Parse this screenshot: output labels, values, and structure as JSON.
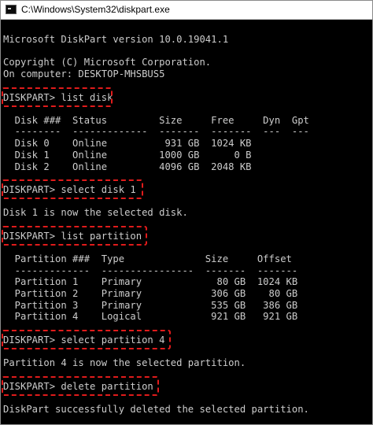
{
  "window": {
    "title": "C:\\Windows\\System32\\diskpart.exe"
  },
  "console": {
    "version_line": "Microsoft DiskPart version 10.0.19041.1",
    "copyright_line": "Copyright (C) Microsoft Corporation.",
    "computer_line": "On computer: DESKTOP-MHSBUS5",
    "cmd_list_disk": "DISKPART> list disk",
    "disk_header": "  Disk ###  Status         Size     Free     Dyn  Gpt",
    "disk_separator": "  --------  -------------  -------  -------  ---  ---",
    "disk_rows": [
      "  Disk 0    Online          931 GB  1024 KB",
      "  Disk 1    Online         1000 GB      0 B",
      "  Disk 2    Online         4096 GB  2048 KB"
    ],
    "cmd_select_disk": "DISKPART> select disk 1",
    "msg_disk_selected": "Disk 1 is now the selected disk.",
    "cmd_list_partition": "DISKPART> list partition",
    "partition_header": "  Partition ###  Type              Size     Offset",
    "partition_separator": "  -------------  ----------------  -------  -------",
    "partition_rows": [
      "  Partition 1    Primary             80 GB  1024 KB",
      "  Partition 2    Primary            306 GB    80 GB",
      "  Partition 3    Primary            535 GB   386 GB",
      "  Partition 4    Logical            921 GB   921 GB"
    ],
    "cmd_select_partition": "DISKPART> select partition 4",
    "msg_partition_selected": "Partition 4 is now the selected partition.",
    "cmd_delete_partition": "DISKPART> delete partition",
    "msg_deleted": "DiskPart successfully deleted the selected partition."
  },
  "colors": {
    "console_background": "#000000",
    "console_text": "#cccccc",
    "highlight": "#e01b1b"
  },
  "icons": {
    "app": "console-app-icon"
  }
}
